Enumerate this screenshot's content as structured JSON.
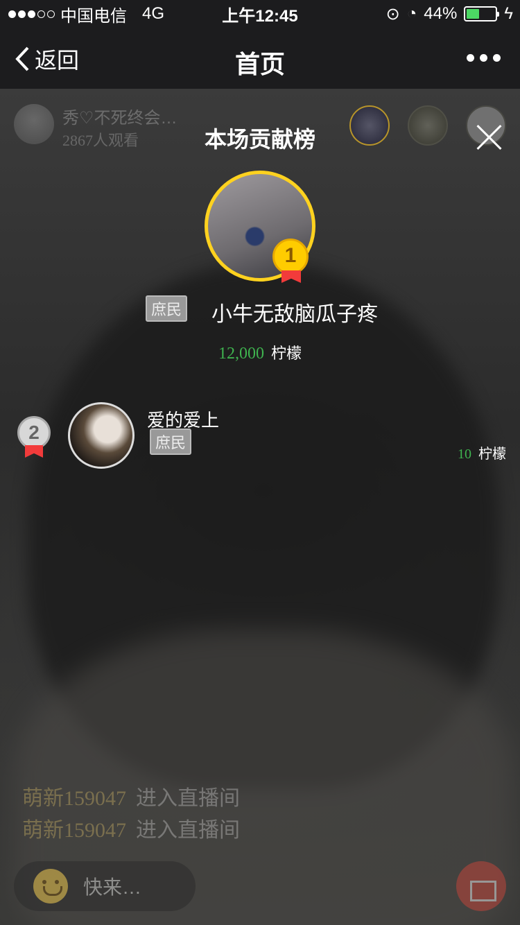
{
  "status": {
    "carrier": "中国电信",
    "network": "4G",
    "time": "上午12:45",
    "battery": "44%",
    "battery_level": 0.44
  },
  "nav": {
    "back_label": "返回",
    "title": "首页"
  },
  "host": {
    "name": "秀♡不死终会…",
    "viewers": "2867人观看"
  },
  "panel": {
    "title": "本场贡献榜"
  },
  "first": {
    "rank": "1",
    "tag": "庶民",
    "name": "小牛无敌脑瓜子疼",
    "score": "12,000",
    "unit": "柠檬"
  },
  "second": {
    "rank": "2",
    "tag": "庶民",
    "name": "爱的爱上",
    "score": "10",
    "unit": "柠檬"
  },
  "chat": [
    {
      "user": "萌新159047",
      "text": "进入直播间"
    },
    {
      "user": "萌新159047",
      "text": "进入直播间"
    }
  ],
  "input": {
    "placeholder": "快来…"
  },
  "colors": {
    "gold": "#ffd21f",
    "score_green": "#3fb34f",
    "ribbon_red": "#f23b3b"
  }
}
